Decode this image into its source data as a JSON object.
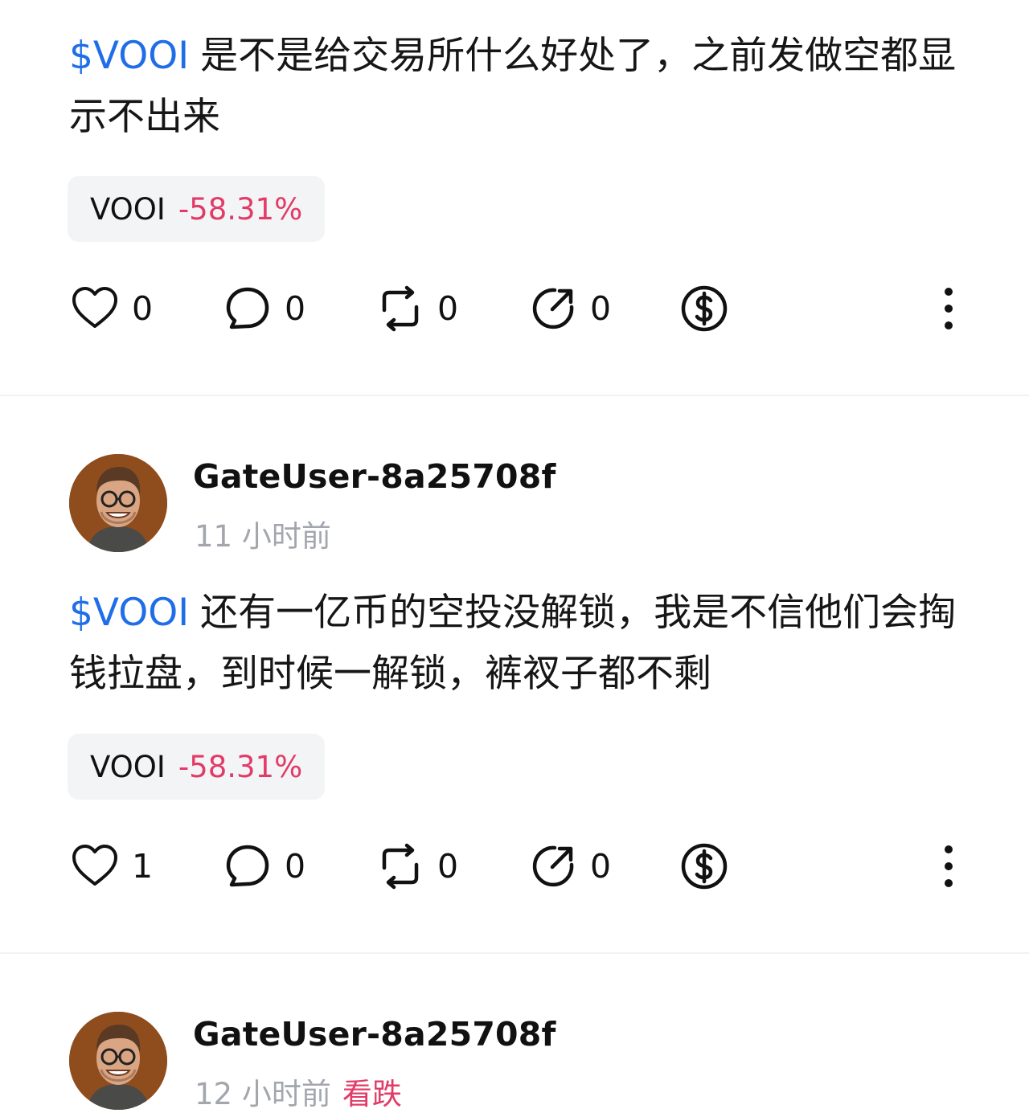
{
  "posts": [
    {
      "cashtag": "$VOOI",
      "text": "是不是给交易所什么好处了，之前发做空都显示不出来",
      "ticker": {
        "symbol": "VOOI",
        "change": "-58.31%"
      },
      "likes": "0",
      "comments": "0",
      "reposts": "0",
      "shares": "0"
    },
    {
      "author": "GateUser-8a25708f",
      "time": "11 小时前",
      "cashtag": "$VOOI",
      "text": "还有一亿币的空投没解锁，我是不信他们会掏钱拉盘，到时候一解锁，裤衩子都不剩",
      "ticker": {
        "symbol": "VOOI",
        "change": "-58.31%"
      },
      "likes": "1",
      "comments": "0",
      "reposts": "0",
      "shares": "0"
    },
    {
      "author": "GateUser-8a25708f",
      "time": "12 小时前",
      "sentiment": "看跌"
    }
  ],
  "icons": {
    "like": "heart-icon",
    "comment": "comment-bubble-icon",
    "repost": "repost-icon",
    "share": "share-icon",
    "tip": "dollar-coin-icon",
    "more": "more-vertical-icon"
  },
  "colors": {
    "cashtag": "#1f6ee8",
    "negative": "#e23b67",
    "muted": "#a3a6ad"
  }
}
